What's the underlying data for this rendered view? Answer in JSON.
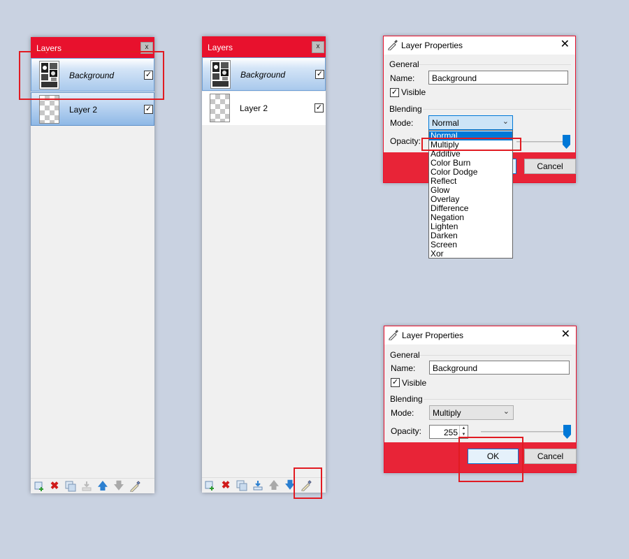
{
  "panel1": {
    "title": "Layers",
    "close": "x",
    "layers": [
      {
        "name": "Background",
        "checked": "✓"
      },
      {
        "name": "Layer 2",
        "checked": "✓"
      }
    ]
  },
  "panel2": {
    "title": "Layers",
    "close": "x",
    "layers": [
      {
        "name": "Background",
        "checked": "✓"
      },
      {
        "name": "Layer 2",
        "checked": "✓"
      }
    ]
  },
  "toolbar_icons": [
    "add-layer-icon",
    "delete-layer-icon",
    "duplicate-layer-icon",
    "merge-down-icon",
    "move-up-icon",
    "move-down-icon",
    "properties-icon"
  ],
  "dialog1": {
    "title": "Layer Properties",
    "close": "✕",
    "general_label": "General",
    "name_label": "Name:",
    "name_value": "Background",
    "visible_label": "Visible",
    "visible_check": "✓",
    "blending_label": "Blending",
    "mode_label": "Mode:",
    "mode_value": "Normal",
    "opacity_label": "Opacity:",
    "cancel": "Cancel",
    "mode_options": [
      "Normal",
      "Multiply",
      "Additive",
      "Color Burn",
      "Color Dodge",
      "Reflect",
      "Glow",
      "Overlay",
      "Difference",
      "Negation",
      "Lighten",
      "Darken",
      "Screen",
      "Xor"
    ]
  },
  "dialog2": {
    "title": "Layer Properties",
    "close": "✕",
    "general_label": "General",
    "name_label": "Name:",
    "name_value": "Background",
    "visible_label": "Visible",
    "visible_check": "✓",
    "blending_label": "Blending",
    "mode_label": "Mode:",
    "mode_value": "Multiply",
    "opacity_label": "Opacity:",
    "opacity_value": "255",
    "ok": "OK",
    "cancel": "Cancel"
  },
  "colors": {
    "accent": "#e8112d",
    "selection": "#0078d7",
    "annotation": "#e11b22"
  }
}
